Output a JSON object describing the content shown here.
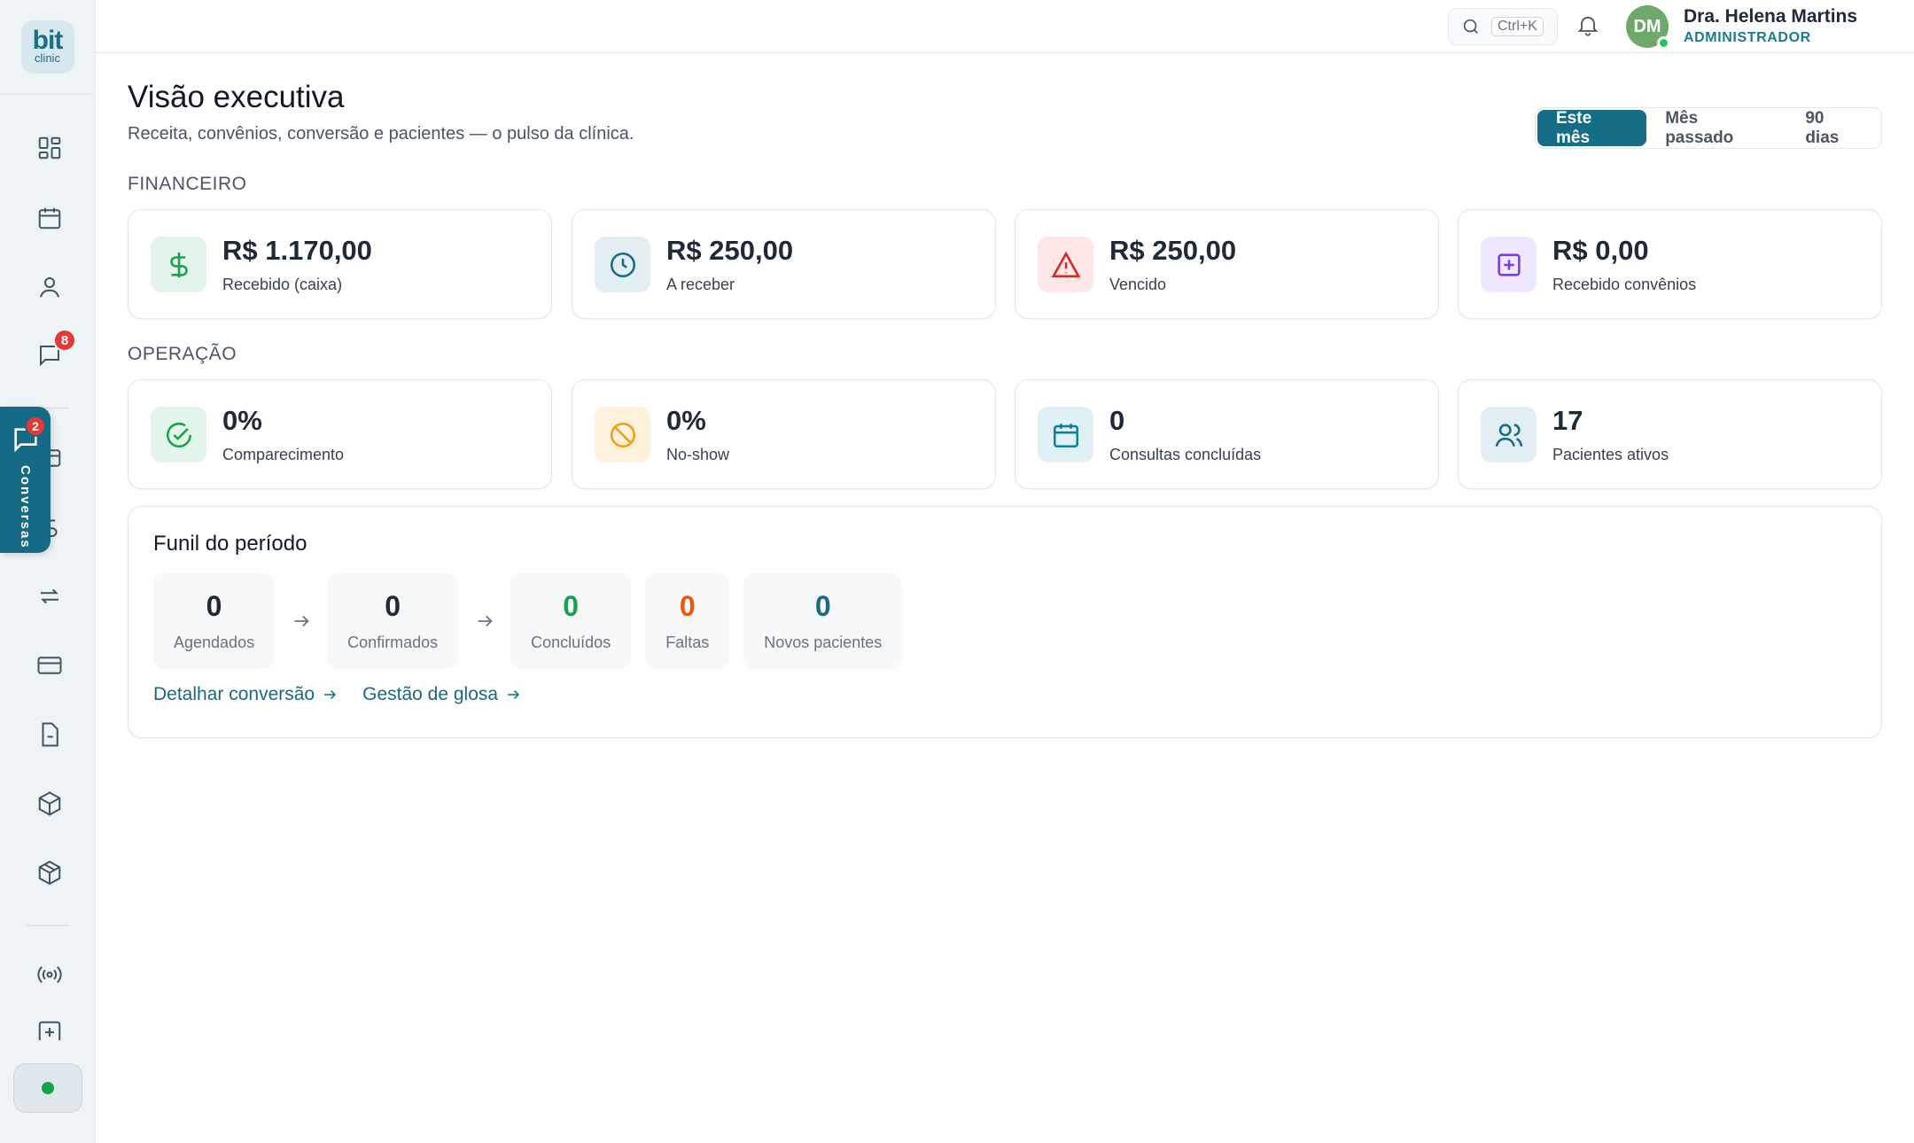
{
  "brand": {
    "logo_line1": "bit",
    "logo_line2": "clinic"
  },
  "sidebar": {
    "chat_badge": "8",
    "icons": [
      "dashboard-icon",
      "calendar-icon",
      "user-icon",
      "chat-icon",
      "card-icon",
      "dollar-icon",
      "transfer-icon",
      "credit-card-icon",
      "document-icon",
      "box-icon",
      "package-icon",
      "broadcast-icon",
      "plus-square-icon"
    ]
  },
  "chat_tab": {
    "label": "Conversas",
    "badge": "2"
  },
  "topbar": {
    "search_shortcut": "Ctrl+K",
    "user": {
      "initials": "DM",
      "name": "Dra. Helena Martins",
      "role": "ADMINISTRADOR"
    }
  },
  "page": {
    "title": "Visão executiva",
    "subtitle": "Receita, convênios, conversão e pacientes — o pulso da clínica."
  },
  "period": {
    "options": [
      "Este mês",
      "Mês passado",
      "90 dias"
    ],
    "selected": "Este mês"
  },
  "financeiro": {
    "label": "FINANCEIRO",
    "cards": [
      {
        "value": "R$ 1.170,00",
        "label": "Recebido (caixa)",
        "icon": "dollar-icon",
        "color": "#16a34a",
        "bg": "#e3f4ea"
      },
      {
        "value": "R$ 250,00",
        "label": "A receber",
        "icon": "clock-icon",
        "color": "#166d86",
        "bg": "#e2eef2"
      },
      {
        "value": "R$ 250,00",
        "label": "Vencido",
        "icon": "warning-icon",
        "color": "#dc2626",
        "bg": "#fde7e7"
      },
      {
        "value": "R$ 0,00",
        "label": "Recebido convênios",
        "icon": "plus-square-icon",
        "color": "#7c3aed",
        "bg": "#efe7fd"
      }
    ]
  },
  "operacao": {
    "label": "OPERAÇÃO",
    "cards": [
      {
        "value": "0%",
        "label": "Comparecimento",
        "icon": "check-circle-icon",
        "color": "#16a34a",
        "bg": "#e3f4ea"
      },
      {
        "value": "0%",
        "label": "No-show",
        "icon": "ban-icon",
        "color": "#f59e0b",
        "bg": "#fdf1dc"
      },
      {
        "value": "0",
        "label": "Consultas concluídas",
        "icon": "calendar-icon",
        "color": "#0e7fa0",
        "bg": "#e0f1f6"
      },
      {
        "value": "17",
        "label": "Pacientes ativos",
        "icon": "users-icon",
        "color": "#166d86",
        "bg": "#e2eef2"
      }
    ]
  },
  "funnel": {
    "title": "Funil do período",
    "stages": [
      {
        "value": "0",
        "label": "Agendados",
        "color": "#1f2937"
      },
      {
        "value": "0",
        "label": "Confirmados",
        "color": "#1f2937"
      },
      {
        "value": "0",
        "label": "Concluídos",
        "color": "#16a34a"
      },
      {
        "value": "0",
        "label": "Faltas",
        "color": "#ea580c"
      },
      {
        "value": "0",
        "label": "Novos pacientes",
        "color": "#176a85"
      }
    ],
    "links": [
      "Detalhar conversão",
      "Gestão de glosa"
    ]
  }
}
